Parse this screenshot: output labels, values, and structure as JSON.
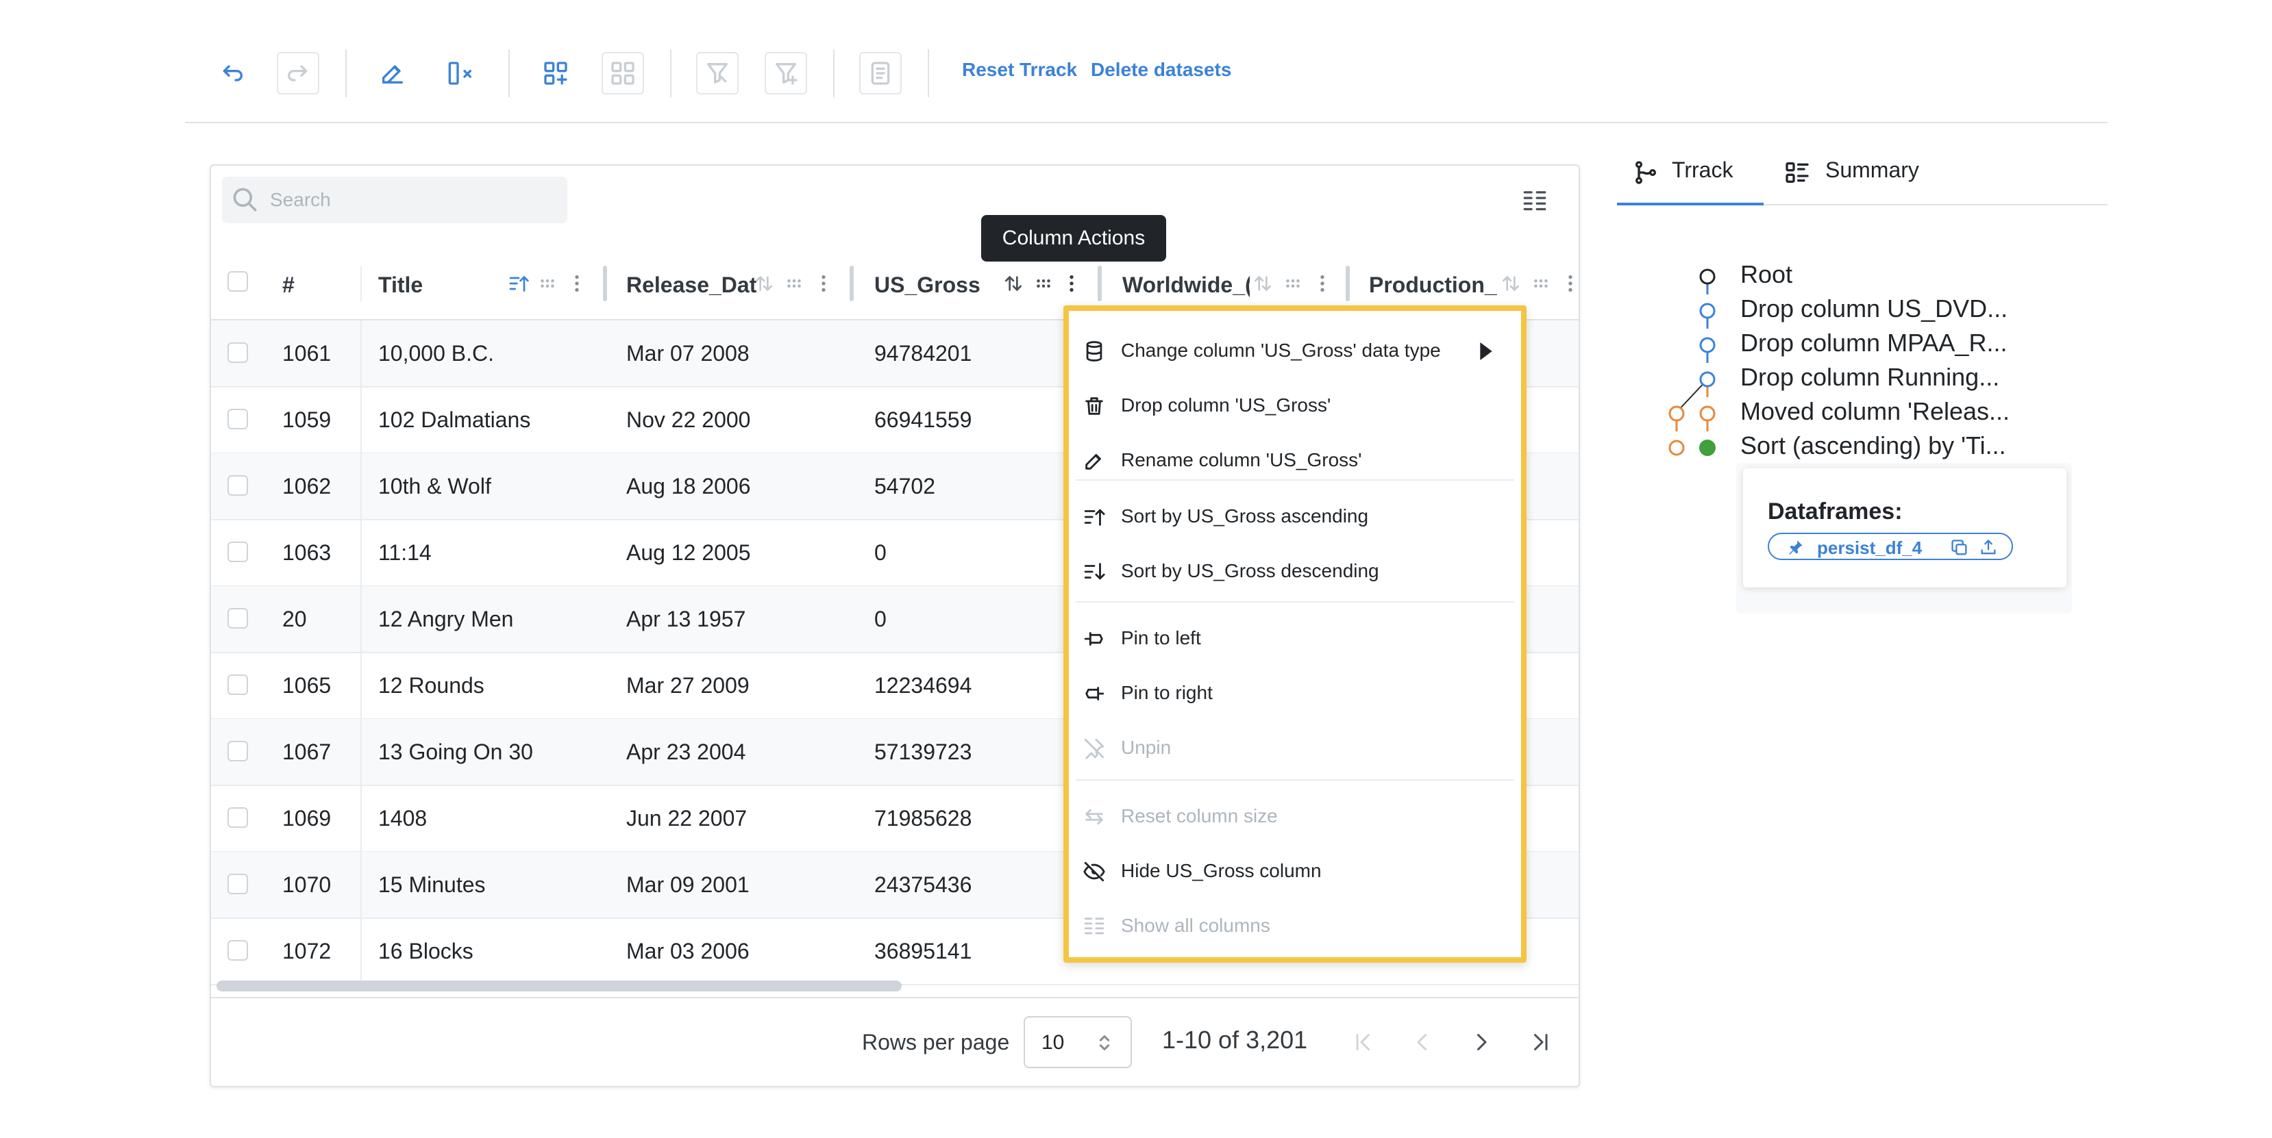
{
  "toolbar": {
    "reset_label": "Reset Trrack",
    "delete_label": "Delete datasets"
  },
  "search": {
    "placeholder": "Search"
  },
  "table": {
    "headers": {
      "index": "#",
      "title": "Title",
      "release_date": "Release_Dat",
      "us_gross": "US_Gross",
      "worldwide": "Worldwide_(",
      "production": "Production_"
    },
    "rows": [
      {
        "index": "1061",
        "title": "10,000 B.C.",
        "release_date": "Mar 07 2008",
        "us_gross": "94784201"
      },
      {
        "index": "1059",
        "title": "102 Dalmatians",
        "release_date": "Nov 22 2000",
        "us_gross": "66941559"
      },
      {
        "index": "1062",
        "title": "10th & Wolf",
        "release_date": "Aug 18 2006",
        "us_gross": "54702"
      },
      {
        "index": "1063",
        "title": "11:14",
        "release_date": "Aug 12 2005",
        "us_gross": "0"
      },
      {
        "index": "20",
        "title": "12 Angry Men",
        "release_date": "Apr 13 1957",
        "us_gross": "0"
      },
      {
        "index": "1065",
        "title": "12 Rounds",
        "release_date": "Mar 27 2009",
        "us_gross": "12234694"
      },
      {
        "index": "1067",
        "title": "13 Going On 30",
        "release_date": "Apr 23 2004",
        "us_gross": "57139723"
      },
      {
        "index": "1069",
        "title": "1408",
        "release_date": "Jun 22 2007",
        "us_gross": "71985628"
      },
      {
        "index": "1070",
        "title": "15 Minutes",
        "release_date": "Mar 09 2001",
        "us_gross": "24375436"
      },
      {
        "index": "1072",
        "title": "16 Blocks",
        "release_date": "Mar 03 2006",
        "us_gross": "36895141"
      }
    ]
  },
  "pagination": {
    "rows_per_page_label": "Rows per page",
    "rows_per_page_value": "10",
    "range_text": "1-10 of 3,201"
  },
  "tooltip": {
    "text": "Column Actions"
  },
  "column_menu": {
    "items": [
      {
        "label": "Change column 'US_Gross' data type",
        "icon": "database-icon",
        "disabled": false
      },
      {
        "label": "Drop column 'US_Gross'",
        "icon": "trash-icon",
        "disabled": false
      },
      {
        "label": "Rename column 'US_Gross'",
        "icon": "edit-icon",
        "disabled": false
      },
      {
        "label": "Sort by US_Gross ascending",
        "icon": "sort-ascending-icon",
        "disabled": false
      },
      {
        "label": "Sort by US_Gross descending",
        "icon": "sort-descending-icon",
        "disabled": false
      },
      {
        "label": "Pin to left",
        "icon": "pin-left-icon",
        "disabled": false
      },
      {
        "label": "Pin to right",
        "icon": "pin-right-icon",
        "disabled": false
      },
      {
        "label": "Unpin",
        "icon": "unpin-icon",
        "disabled": true
      },
      {
        "label": "Reset column size",
        "icon": "reset-size-icon",
        "disabled": true
      },
      {
        "label": "Hide US_Gross column",
        "icon": "eye-off-icon",
        "disabled": false
      },
      {
        "label": "Show all columns",
        "icon": "columns-icon",
        "disabled": true
      }
    ]
  },
  "sidebar": {
    "tabs": [
      {
        "label": "Trrack",
        "icon": "git-branch-icon",
        "active": true
      },
      {
        "label": "Summary",
        "icon": "list-details-icon",
        "active": false
      }
    ],
    "tree": [
      "Root",
      "Drop column US_DVD...",
      "Drop column MPAA_R...",
      "Drop column Running...",
      "Moved column 'Releas...",
      "Sort (ascending) by 'Ti..."
    ],
    "dataframes_title": "Dataframes:",
    "dataframe_chip": "persist_df_4"
  },
  "colors": {
    "accent": "#3b82d8",
    "highlight_border": "#f5c542",
    "branch_orange": "#e8893a",
    "current_node": "#40a03c"
  }
}
